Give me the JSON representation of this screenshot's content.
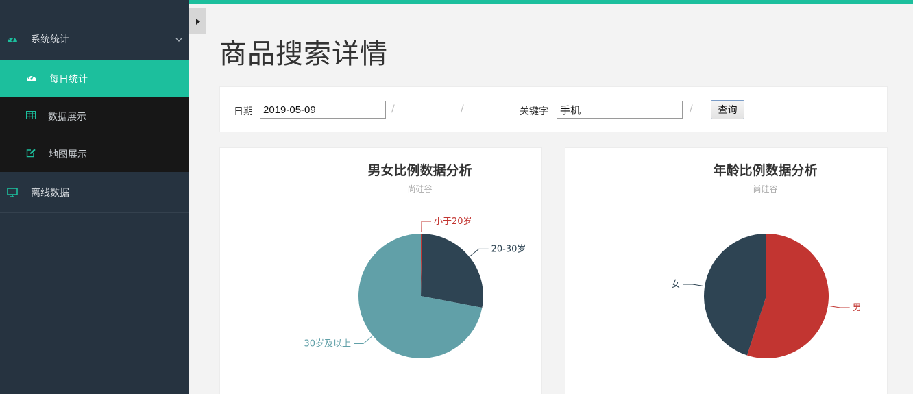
{
  "sidebar": {
    "section_stats": {
      "label": "系统统计",
      "icon": "dashboard-icon"
    },
    "items": [
      {
        "label": "每日统计",
        "icon": "dashboard-icon",
        "active": true
      },
      {
        "label": "数据展示",
        "icon": "table-icon",
        "active": false
      },
      {
        "label": "地图展示",
        "icon": "edit-icon",
        "active": false
      }
    ],
    "section_offline": {
      "label": "离线数据",
      "icon": "monitor-icon"
    }
  },
  "page": {
    "title": "商品搜索详情"
  },
  "filter": {
    "date_label": "日期",
    "date_value": "2019-05-09",
    "separator": "/",
    "keyword_label": "关键字",
    "keyword_value": "手机",
    "query_button": "查询"
  },
  "colors": {
    "accent": "#1cbf9d",
    "sidebar_bg": "#263340",
    "dark_slice": "#2e4453",
    "teal_slice": "#61a0a8",
    "red_slice": "#c23531"
  },
  "chart_data": [
    {
      "type": "pie",
      "title": "男女比例数据分析",
      "subtitle": "尚硅谷",
      "slices": [
        {
          "label": "小于20岁",
          "value": 0.3,
          "color": "#c23531"
        },
        {
          "label": "20-30岁",
          "value": 27.7,
          "color": "#2e4453"
        },
        {
          "label": "30岁及以上",
          "value": 72.0,
          "color": "#61a0a8"
        }
      ]
    },
    {
      "type": "pie",
      "title": "年龄比例数据分析",
      "subtitle": "尚硅谷",
      "slices": [
        {
          "label": "男",
          "value": 55.0,
          "color": "#c23531"
        },
        {
          "label": "女",
          "value": 45.0,
          "color": "#2e4453"
        }
      ]
    }
  ]
}
